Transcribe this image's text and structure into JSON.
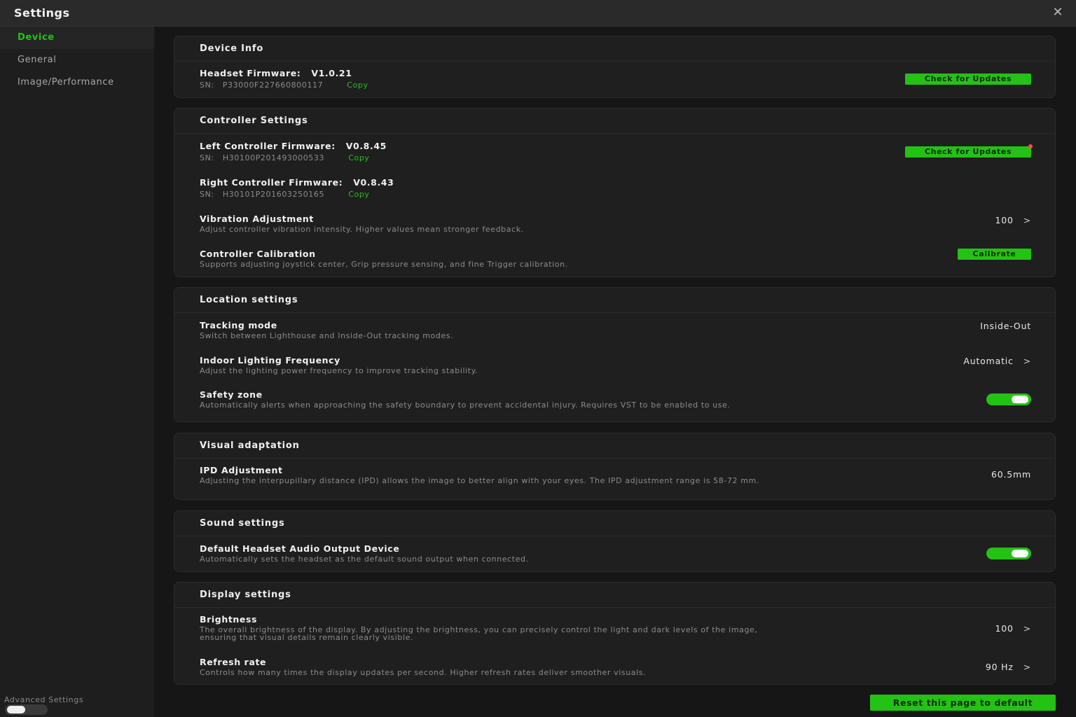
{
  "window": {
    "title": "Settings",
    "close_icon": "✕"
  },
  "sidebar": {
    "items": [
      {
        "label": "Device",
        "active": true
      },
      {
        "label": "General",
        "active": false
      },
      {
        "label": "Image/Performance",
        "active": false
      }
    ],
    "advanced_label": "Advanced Settings",
    "advanced_enabled": false
  },
  "accent_color": "#22c313",
  "device_info": {
    "header": "Device Info",
    "headset_label": "Headset Firmware:",
    "headset_version": "V1.0.21",
    "sn_label": "SN:",
    "sn_value": "P33000F227660800117",
    "copy_label": "Copy",
    "update_label": "Check for Updates"
  },
  "controller": {
    "header": "Controller Settings",
    "left_label": "Left Controller Firmware:",
    "left_version": "V0.8.45",
    "left_sn": "H30100P201493000533",
    "right_label": "Right Controller Firmware:",
    "right_version": "V0.8.43",
    "right_sn": "H30101P201603250165",
    "sn_label": "SN:",
    "copy_label": "Copy",
    "update_label": "Check for Updates",
    "vibration_title": "Vibration Adjustment",
    "vibration_desc": "Adjust controller vibration intensity. Higher values mean stronger feedback.",
    "vibration_value": "100",
    "calibration_title": "Controller Calibration",
    "calibration_desc": "Supports adjusting joystick center, Grip pressure sensing, and fine Trigger calibration.",
    "calibrate_label": "Calibrate"
  },
  "location": {
    "header": "Location settings",
    "tracking_title": "Tracking mode",
    "tracking_desc": "Switch between Lighthouse and Inside-Out tracking modes.",
    "tracking_value": "Inside-Out",
    "lighting_title": "Indoor Lighting Frequency",
    "lighting_desc": "Adjust the lighting power frequency to improve tracking stability.",
    "lighting_value": "Automatic",
    "safety_title": "Safety zone",
    "safety_desc": "Automatically alerts when approaching the safety boundary to prevent accidental injury. Requires VST to be enabled to use.",
    "safety_enabled": true
  },
  "visual": {
    "header": "Visual adaptation",
    "ipd_title": "IPD Adjustment",
    "ipd_desc": "Adjusting the interpupillary distance (IPD) allows the image to better align with your eyes. The IPD adjustment range is 58-72 mm.",
    "ipd_value": "60.5mm"
  },
  "sound": {
    "header": "Sound settings",
    "audio_title": "Default Headset Audio Output Device",
    "audio_desc": "Automatically sets the headset as the default sound output when connected.",
    "audio_enabled": true
  },
  "display": {
    "header": "Display settings",
    "brightness_title": "Brightness",
    "brightness_desc": "The overall brightness of the display. By adjusting the brightness, you can precisely control the light and dark levels of the image, ensuring that visual details remain clearly visible.",
    "brightness_value": "100",
    "refresh_title": "Refresh rate",
    "refresh_desc": "Controls how many times the display updates per second. Higher refresh rates deliver smoother visuals.",
    "refresh_value": "90 Hz"
  },
  "chevron": ">",
  "reset_label": "Reset this page to default"
}
